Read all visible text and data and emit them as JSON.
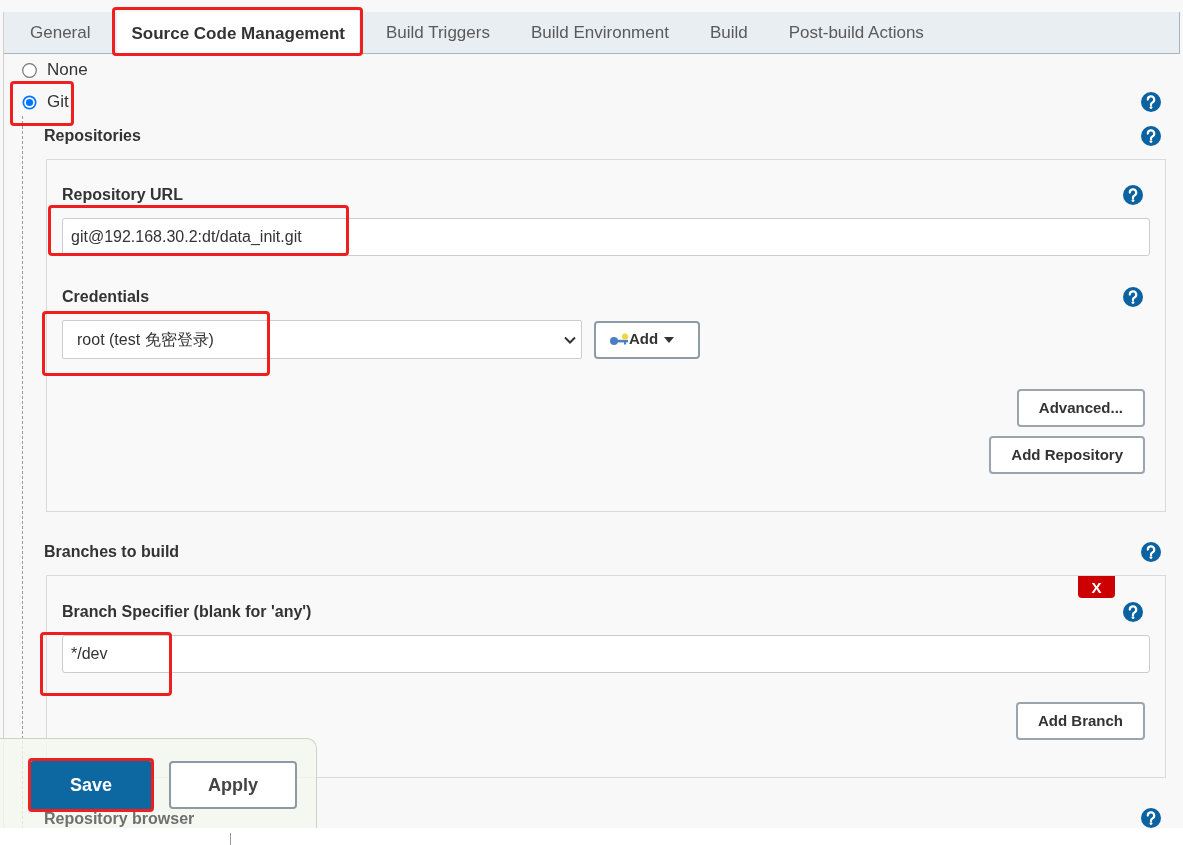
{
  "tabs": [
    {
      "label": "General",
      "selected": false,
      "highlighted": false
    },
    {
      "label": "Source Code Management",
      "selected": true,
      "highlighted": true
    },
    {
      "label": "Build Triggers",
      "selected": false,
      "highlighted": false
    },
    {
      "label": "Build Environment",
      "selected": false,
      "highlighted": false
    },
    {
      "label": "Build",
      "selected": false,
      "highlighted": false
    },
    {
      "label": "Post-build Actions",
      "selected": false,
      "highlighted": false
    }
  ],
  "scm_options": [
    {
      "label": "None",
      "selected": false,
      "highlighted": false,
      "help": false
    },
    {
      "label": "Git",
      "selected": true,
      "highlighted": true,
      "help": true
    }
  ],
  "repositories": {
    "title": "Repositories",
    "items": [
      {
        "url_label": "Repository URL",
        "url": "git@192.168.30.2:dt/data_init.git",
        "url_highlighted": true,
        "credentials_label": "Credentials",
        "credentials": "root (test 免密登录)",
        "credentials_highlighted": true,
        "add_button": "Add",
        "advanced_button": "Advanced..."
      }
    ],
    "add_button": "Add Repository"
  },
  "branches": {
    "title": "Branches to build",
    "items": [
      {
        "delete_button": "X",
        "label": "Branch Specifier (blank for 'any')",
        "value": "*/dev",
        "highlighted": true
      }
    ],
    "add_button": "Add Branch"
  },
  "repository_browser": {
    "label": "Repository browser"
  },
  "footer": {
    "buttons": [
      {
        "label": "Save",
        "kind": "primary",
        "highlighted": true
      },
      {
        "label": "Apply",
        "kind": "secondary",
        "highlighted": false
      }
    ]
  }
}
